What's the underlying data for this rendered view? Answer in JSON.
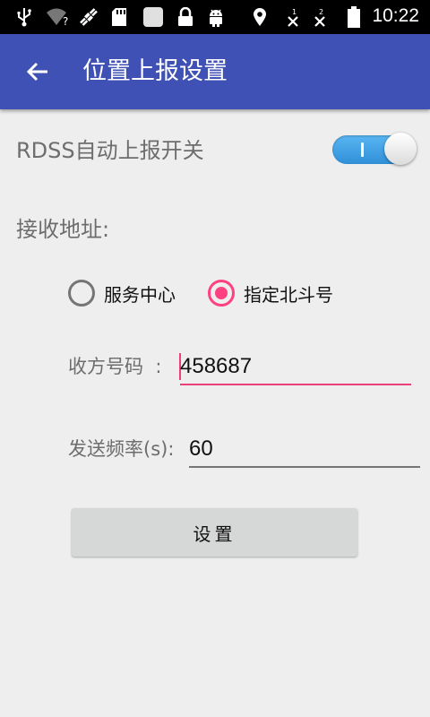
{
  "status_bar": {
    "time": "10:22",
    "icons": [
      "usb-icon",
      "wifi-question-icon",
      "satellite-icon",
      "sd-card-icon",
      "blank-notification-icon",
      "lock-icon",
      "android-icon",
      "location-icon",
      "sim1-no-signal-icon",
      "sim2-no-signal-icon",
      "battery-icon"
    ]
  },
  "appbar": {
    "title": "位置上报设置"
  },
  "auto_report": {
    "label": "RDSS自动上报开关",
    "switch_on": true
  },
  "receive_address": {
    "label": "接收地址:",
    "options": [
      {
        "label": "服务中心",
        "checked": false
      },
      {
        "label": "指定北斗号",
        "checked": true
      }
    ]
  },
  "recipient": {
    "label": "收方号码  :",
    "value": "458687"
  },
  "frequency": {
    "label": "发送频率(s):",
    "value": "60"
  },
  "set_button": {
    "label": "设置"
  },
  "colors": {
    "appbar": "#3f51b5",
    "accent": "#ff4081",
    "switch_track": "#3d9be2"
  }
}
